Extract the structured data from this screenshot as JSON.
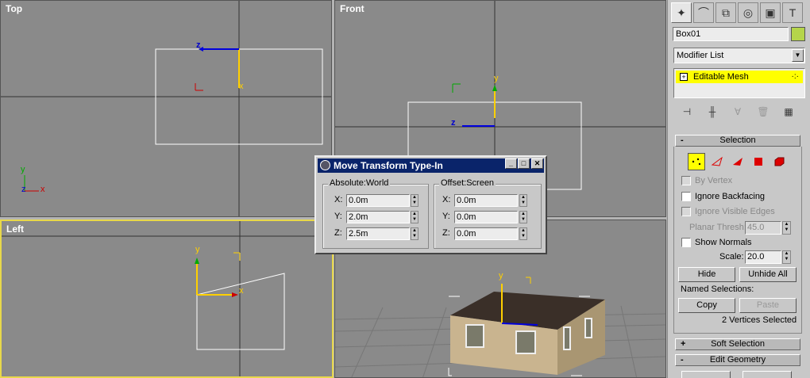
{
  "viewports": {
    "top": {
      "label": "Top"
    },
    "front": {
      "label": "Front"
    },
    "left": {
      "label": "Left"
    },
    "perspective": {
      "label": ""
    }
  },
  "axes": {
    "x": "x",
    "y": "y",
    "z": "z"
  },
  "command_panel": {
    "tabs": [
      "create-icon",
      "modify-icon",
      "hierarchy-icon",
      "motion-icon",
      "display-icon",
      "utilities-icon"
    ],
    "object_name": "Box01",
    "object_color": "#b5d54a",
    "modifier_list": "Modifier List",
    "stack_item": "Editable Mesh",
    "selection": {
      "title": "Selection",
      "by_vertex": "By Vertex",
      "ignore_backfacing": "Ignore Backfacing",
      "ignore_visible_edges": "Ignore Visible Edges",
      "planar_thresh_label": "Planar Thresh:",
      "planar_thresh_value": "45.0",
      "show_normals": "Show Normals",
      "scale_label": "Scale:",
      "scale_value": "20.0",
      "hide": "Hide",
      "unhide_all": "Unhide All",
      "named_selections": "Named Selections:",
      "copy": "Copy",
      "paste": "Paste",
      "status": "2 Vertices Selected"
    },
    "soft_selection": "Soft Selection",
    "edit_geometry": "Edit Geometry"
  },
  "dialog": {
    "title": "Move Transform Type-In",
    "absolute": {
      "title": "Absolute:World",
      "x_label": "X:",
      "x": "0.0m",
      "y_label": "Y:",
      "y": "2.0m",
      "z_label": "Z:",
      "z": "2.5m"
    },
    "offset": {
      "title": "Offset:Screen",
      "x_label": "X:",
      "x": "0.0m",
      "y_label": "Y:",
      "y": "0.0m",
      "z_label": "Z:",
      "z": "0.0m"
    }
  }
}
